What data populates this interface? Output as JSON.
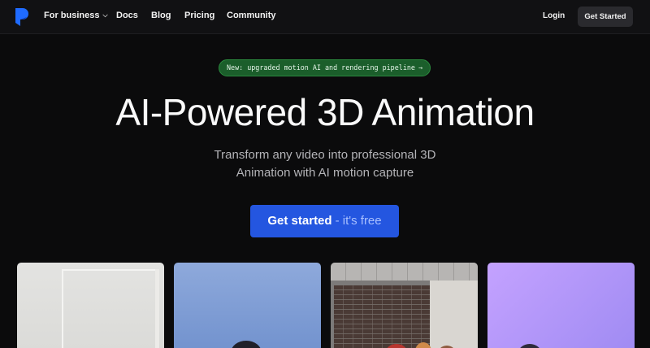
{
  "nav": {
    "logo_icon": "brand-logo-icon",
    "links": {
      "business": "For business",
      "docs": "Docs",
      "blog": "Blog",
      "pricing": "Pricing",
      "community": "Community"
    },
    "login": "Login",
    "get_started": "Get Started"
  },
  "hero": {
    "badge_text": "New: upgraded motion AI and rendering pipeline",
    "badge_arrow": "→",
    "title": "AI-Powered 3D Animation",
    "subtitle_line1": "Transform any video into professional 3D",
    "subtitle_line2": "Animation with AI motion capture",
    "cta_main": "Get started",
    "cta_free": "- it's free"
  },
  "colors": {
    "background": "#0b0b0c",
    "accent_blue": "#2456e0",
    "badge_green": "#1b5e2b",
    "logo_blue": "#1f6bff"
  }
}
